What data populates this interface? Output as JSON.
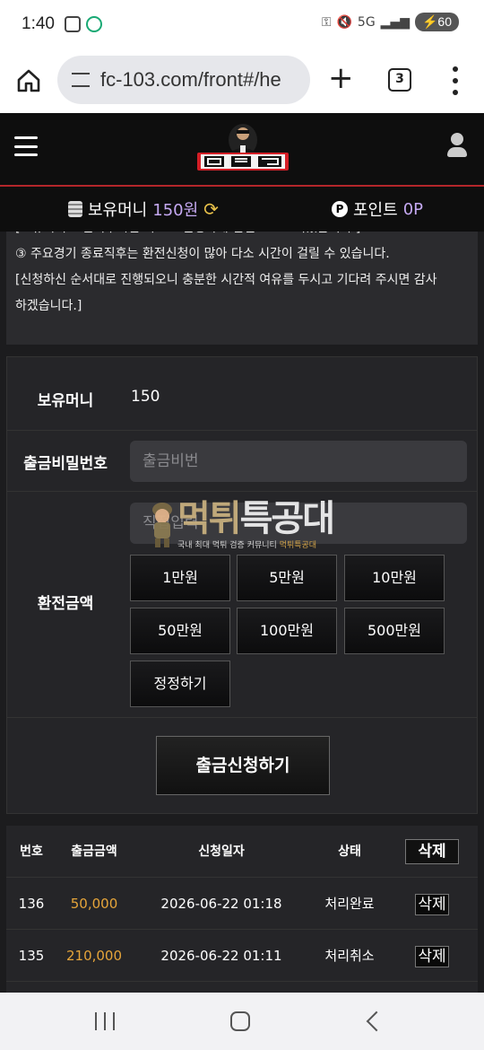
{
  "status_bar": {
    "time": "1:40",
    "battery": "60",
    "network": "5G"
  },
  "browser": {
    "url": "fc-103.com/front#/he",
    "tab_count": "3"
  },
  "money_bar": {
    "balance_label": "보유머니",
    "balance_value": "150원",
    "points_label": "포인트",
    "points_value": "0P"
  },
  "notice": {
    "lines": [
      "[보유머니로 전적주시면 빠르고 진행하게 됩인 보도드리었습니다.]",
      "③ 주요경기 종료직후는 환전신청이 많아 다소 시간이 걸릴 수 있습니다.",
      "[신청하신 순서대로 진행되오니 충분한 시간적 여유를 두시고 기다려 주시면 감사",
      "하겠습니다.]"
    ]
  },
  "form": {
    "balance_label": "보유머니",
    "balance_value": "150",
    "password_label": "출금비밀번호",
    "password_placeholder": "출금비번",
    "amount_label": "환전금액",
    "amount_placeholder": "직접입력",
    "amount_buttons": [
      "1만원",
      "5만원",
      "10만원",
      "50만원",
      "100만원",
      "500만원"
    ],
    "reset_label": "정정하기",
    "submit_label": "출금신청하기"
  },
  "watermark": {
    "title_part1": "먹튀",
    "title_part2": "특공대",
    "subtitle": "국내 최대 먹튀 검증 커뮤니티",
    "subtitle_brand": "먹튀특공대"
  },
  "table": {
    "headers": [
      "번호",
      "출금금액",
      "신청일자",
      "상태",
      "삭제"
    ],
    "rows": [
      {
        "no": "136",
        "amount": "50,000",
        "date": "2026-06-22 01:18",
        "status": "처리완료",
        "action": "삭제"
      },
      {
        "no": "135",
        "amount": "210,000",
        "date": "2026-06-22 01:11",
        "status": "처리취소",
        "action": "삭제"
      }
    ]
  },
  "colors": {
    "accent": "#c5a9f2",
    "amount": "#e6a53a",
    "header_line": "#b3262a"
  }
}
